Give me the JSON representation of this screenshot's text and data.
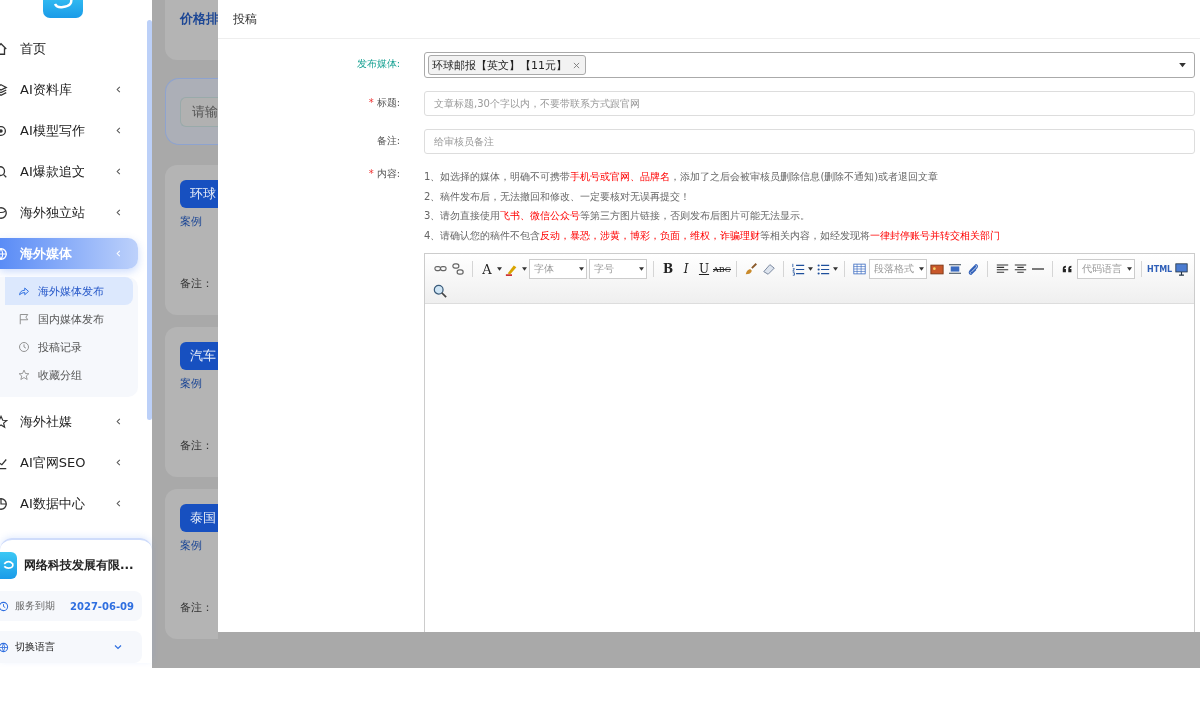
{
  "sidebar": {
    "items": [
      {
        "label": "首页",
        "has_children": false,
        "selected": false
      },
      {
        "label": "AI资料库",
        "has_children": true,
        "selected": false
      },
      {
        "label": "AI模型写作",
        "has_children": true,
        "selected": false
      },
      {
        "label": "AI爆款追文",
        "has_children": true,
        "selected": false
      },
      {
        "label": "海外独立站",
        "has_children": true,
        "selected": false
      },
      {
        "label": "海外媒体",
        "has_children": true,
        "selected": true,
        "children": [
          {
            "label": "海外媒体发布",
            "selected": true
          },
          {
            "label": "国内媒体发布",
            "selected": false
          },
          {
            "label": "投稿记录",
            "selected": false
          },
          {
            "label": "收藏分组",
            "selected": false
          }
        ]
      },
      {
        "label": "海外社媒",
        "has_children": true,
        "selected": false
      },
      {
        "label": "AI官网SEO",
        "has_children": true,
        "selected": false
      },
      {
        "label": "AI数据中心",
        "has_children": true,
        "selected": false
      }
    ],
    "account": {
      "company": "网络科技发展有限...",
      "service_label": "服务到期",
      "service_date": "2027-06-09",
      "language_label": "切换语言",
      "language_expanded": false
    }
  },
  "background": {
    "sort_label": "价格排",
    "search_placeholder": "请输",
    "cards": [
      {
        "button": "环球",
        "link": "案例",
        "note": "备注："
      },
      {
        "button": "汽车",
        "link": "案例",
        "note": "备注："
      },
      {
        "button": "泰国",
        "link": "案例",
        "note": "备注："
      }
    ]
  },
  "dialog": {
    "title": "投稿",
    "fields": [
      {
        "kind": "select",
        "label": "发布媒体:",
        "active": true,
        "tags": [
          "环球邮报【英文】【11元】"
        ]
      },
      {
        "kind": "input",
        "label": "标题:",
        "required_mark": "*",
        "active": false,
        "placeholder": "文章标题,30个字以内，不要带联系方式跟官网"
      },
      {
        "kind": "input",
        "label": "备注:",
        "active": false,
        "placeholder": "给审核员备注"
      },
      {
        "kind": "editor",
        "label": "内容:",
        "required_mark": "*",
        "active": false
      }
    ],
    "notes": [
      [
        {
          "text": "1、如选择的媒体，明确不可携带",
          "highlight": false
        },
        {
          "text": "手机号或官网、品牌名",
          "highlight": true
        },
        {
          "text": "，添加了之后会被审核员删除信息(删除不通知)或者退回文章",
          "highlight": false
        }
      ],
      [
        {
          "text": "2、稿件发布后，无法撤回和修改、一定要核对无误再提交！",
          "highlight": false
        }
      ],
      [
        {
          "text": "3、请勿直接使用",
          "highlight": false
        },
        {
          "text": "飞书、微信公众号",
          "highlight": true
        },
        {
          "text": "等第三方图片链接，否则发布后图片可能无法显示。",
          "highlight": false
        }
      ],
      [
        {
          "text": "4、请确认您的稿件不包含",
          "highlight": false
        },
        {
          "text": "反动，暴恐，涉黄，博彩，负面，维权，诈骗理财",
          "highlight": true
        },
        {
          "text": "等相关内容，如经发现将",
          "highlight": false
        },
        {
          "text": "一律封停账号并转交相关部门",
          "highlight": true
        }
      ]
    ],
    "toolbar": {
      "font_color": "A",
      "bold": "B",
      "italic": "I",
      "underline": "U",
      "strike": "ABC",
      "html": "HTML",
      "selects": [
        "字体",
        "字号",
        "段落格式",
        "代码语言"
      ]
    }
  }
}
